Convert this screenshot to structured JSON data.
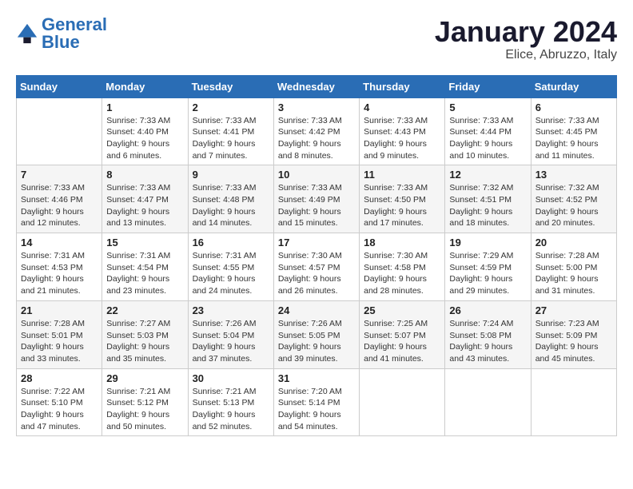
{
  "logo": {
    "text_general": "General",
    "text_blue": "Blue"
  },
  "header": {
    "month": "January 2024",
    "location": "Elice, Abruzzo, Italy"
  },
  "weekdays": [
    "Sunday",
    "Monday",
    "Tuesday",
    "Wednesday",
    "Thursday",
    "Friday",
    "Saturday"
  ],
  "weeks": [
    [
      {
        "day": "",
        "info": ""
      },
      {
        "day": "1",
        "info": "Sunrise: 7:33 AM\nSunset: 4:40 PM\nDaylight: 9 hours\nand 6 minutes."
      },
      {
        "day": "2",
        "info": "Sunrise: 7:33 AM\nSunset: 4:41 PM\nDaylight: 9 hours\nand 7 minutes."
      },
      {
        "day": "3",
        "info": "Sunrise: 7:33 AM\nSunset: 4:42 PM\nDaylight: 9 hours\nand 8 minutes."
      },
      {
        "day": "4",
        "info": "Sunrise: 7:33 AM\nSunset: 4:43 PM\nDaylight: 9 hours\nand 9 minutes."
      },
      {
        "day": "5",
        "info": "Sunrise: 7:33 AM\nSunset: 4:44 PM\nDaylight: 9 hours\nand 10 minutes."
      },
      {
        "day": "6",
        "info": "Sunrise: 7:33 AM\nSunset: 4:45 PM\nDaylight: 9 hours\nand 11 minutes."
      }
    ],
    [
      {
        "day": "7",
        "info": "Sunrise: 7:33 AM\nSunset: 4:46 PM\nDaylight: 9 hours\nand 12 minutes."
      },
      {
        "day": "8",
        "info": "Sunrise: 7:33 AM\nSunset: 4:47 PM\nDaylight: 9 hours\nand 13 minutes."
      },
      {
        "day": "9",
        "info": "Sunrise: 7:33 AM\nSunset: 4:48 PM\nDaylight: 9 hours\nand 14 minutes."
      },
      {
        "day": "10",
        "info": "Sunrise: 7:33 AM\nSunset: 4:49 PM\nDaylight: 9 hours\nand 15 minutes."
      },
      {
        "day": "11",
        "info": "Sunrise: 7:33 AM\nSunset: 4:50 PM\nDaylight: 9 hours\nand 17 minutes."
      },
      {
        "day": "12",
        "info": "Sunrise: 7:32 AM\nSunset: 4:51 PM\nDaylight: 9 hours\nand 18 minutes."
      },
      {
        "day": "13",
        "info": "Sunrise: 7:32 AM\nSunset: 4:52 PM\nDaylight: 9 hours\nand 20 minutes."
      }
    ],
    [
      {
        "day": "14",
        "info": "Sunrise: 7:31 AM\nSunset: 4:53 PM\nDaylight: 9 hours\nand 21 minutes."
      },
      {
        "day": "15",
        "info": "Sunrise: 7:31 AM\nSunset: 4:54 PM\nDaylight: 9 hours\nand 23 minutes."
      },
      {
        "day": "16",
        "info": "Sunrise: 7:31 AM\nSunset: 4:55 PM\nDaylight: 9 hours\nand 24 minutes."
      },
      {
        "day": "17",
        "info": "Sunrise: 7:30 AM\nSunset: 4:57 PM\nDaylight: 9 hours\nand 26 minutes."
      },
      {
        "day": "18",
        "info": "Sunrise: 7:30 AM\nSunset: 4:58 PM\nDaylight: 9 hours\nand 28 minutes."
      },
      {
        "day": "19",
        "info": "Sunrise: 7:29 AM\nSunset: 4:59 PM\nDaylight: 9 hours\nand 29 minutes."
      },
      {
        "day": "20",
        "info": "Sunrise: 7:28 AM\nSunset: 5:00 PM\nDaylight: 9 hours\nand 31 minutes."
      }
    ],
    [
      {
        "day": "21",
        "info": "Sunrise: 7:28 AM\nSunset: 5:01 PM\nDaylight: 9 hours\nand 33 minutes."
      },
      {
        "day": "22",
        "info": "Sunrise: 7:27 AM\nSunset: 5:03 PM\nDaylight: 9 hours\nand 35 minutes."
      },
      {
        "day": "23",
        "info": "Sunrise: 7:26 AM\nSunset: 5:04 PM\nDaylight: 9 hours\nand 37 minutes."
      },
      {
        "day": "24",
        "info": "Sunrise: 7:26 AM\nSunset: 5:05 PM\nDaylight: 9 hours\nand 39 minutes."
      },
      {
        "day": "25",
        "info": "Sunrise: 7:25 AM\nSunset: 5:07 PM\nDaylight: 9 hours\nand 41 minutes."
      },
      {
        "day": "26",
        "info": "Sunrise: 7:24 AM\nSunset: 5:08 PM\nDaylight: 9 hours\nand 43 minutes."
      },
      {
        "day": "27",
        "info": "Sunrise: 7:23 AM\nSunset: 5:09 PM\nDaylight: 9 hours\nand 45 minutes."
      }
    ],
    [
      {
        "day": "28",
        "info": "Sunrise: 7:22 AM\nSunset: 5:10 PM\nDaylight: 9 hours\nand 47 minutes."
      },
      {
        "day": "29",
        "info": "Sunrise: 7:21 AM\nSunset: 5:12 PM\nDaylight: 9 hours\nand 50 minutes."
      },
      {
        "day": "30",
        "info": "Sunrise: 7:21 AM\nSunset: 5:13 PM\nDaylight: 9 hours\nand 52 minutes."
      },
      {
        "day": "31",
        "info": "Sunrise: 7:20 AM\nSunset: 5:14 PM\nDaylight: 9 hours\nand 54 minutes."
      },
      {
        "day": "",
        "info": ""
      },
      {
        "day": "",
        "info": ""
      },
      {
        "day": "",
        "info": ""
      }
    ]
  ]
}
